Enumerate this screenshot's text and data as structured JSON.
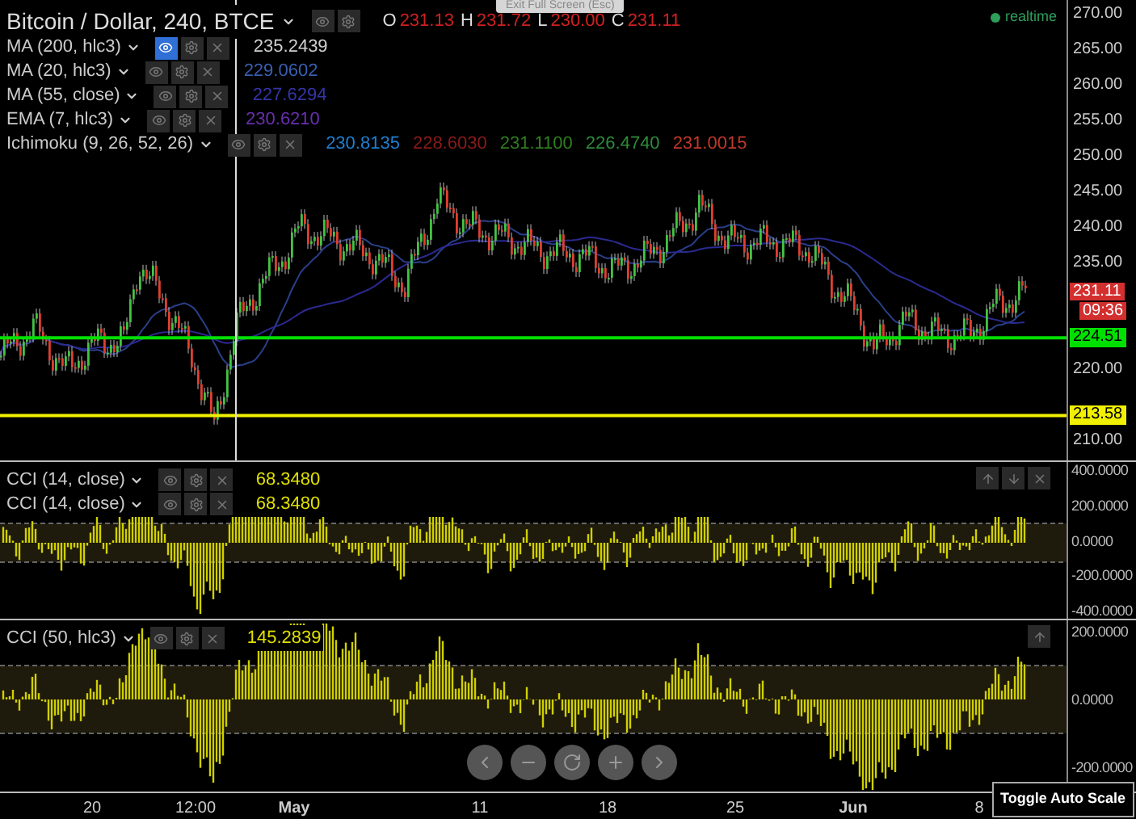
{
  "tooltip": "Exit Full Screen (Esc)",
  "main_pane": {
    "title": "Bitcoin / Dollar, 240, BTCE",
    "ohlc": [
      {
        "label": "O",
        "value": "231.13"
      },
      {
        "label": "H",
        "value": "231.72"
      },
      {
        "label": "L",
        "value": "230.00"
      },
      {
        "label": "C",
        "value": "231.11"
      }
    ],
    "status": {
      "label": "realtime",
      "color": "#2e9e5b"
    },
    "indicators": [
      {
        "name": "MA (200, hlc3)",
        "selected": true,
        "values": [
          {
            "text": "235.2439",
            "color": "#d0d0d0"
          }
        ]
      },
      {
        "name": "MA (20, hlc3)",
        "selected": false,
        "values": [
          {
            "text": "229.0602",
            "color": "#3a5fb0"
          }
        ]
      },
      {
        "name": "MA (55, close)",
        "selected": false,
        "values": [
          {
            "text": "227.6294",
            "color": "#3535a8"
          }
        ]
      },
      {
        "name": "EMA (7, hlc3)",
        "selected": false,
        "values": [
          {
            "text": "230.6210",
            "color": "#6a2fb0"
          }
        ]
      },
      {
        "name": "Ichimoku (9, 26, 52, 26)",
        "selected": false,
        "values": [
          {
            "text": "230.8135",
            "color": "#1e7fd0"
          },
          {
            "text": "228.6030",
            "color": "#8b1a1a"
          },
          {
            "text": "231.1100",
            "color": "#2f7d1f"
          },
          {
            "text": "226.4740",
            "color": "#2e8b3a"
          },
          {
            "text": "231.0015",
            "color": "#c0392b"
          }
        ]
      }
    ],
    "price_axis": [
      "270.00",
      "265.00",
      "260.00",
      "255.00",
      "250.00",
      "245.00",
      "240.00",
      "235.00",
      "220.00",
      "210.00"
    ],
    "price_badges": [
      {
        "text": "231.11",
        "color": "#d32f2f"
      },
      {
        "text": "09:36",
        "color": "#d32f2f"
      }
    ],
    "horizontal_lines": [
      {
        "text": "224.51",
        "color": "#00e000"
      },
      {
        "text": "213.58",
        "color": "#f0f000"
      }
    ]
  },
  "cci_panes": [
    {
      "indicators": [
        {
          "name": "CCI (14, close)",
          "value": "68.3480"
        },
        {
          "name": "CCI (14, close)",
          "value": "68.3480"
        }
      ],
      "axis": [
        "400.0000",
        "200.0000",
        "0.0000",
        "-200.0000",
        "-400.0000"
      ],
      "controls": [
        {
          "kind": "up"
        },
        {
          "kind": "down"
        },
        {
          "kind": "close"
        }
      ]
    },
    {
      "indicators": [
        {
          "name": "CCI (50, hlc3)",
          "value": "145.2839"
        }
      ],
      "axis": [
        "200.0000",
        "0.0000",
        "-200.0000"
      ],
      "controls": [
        {
          "kind": "up"
        }
      ]
    }
  ],
  "time_axis": [
    {
      "text": "20",
      "bold": false
    },
    {
      "text": "12:00",
      "bold": false
    },
    {
      "text": "May",
      "bold": true
    },
    {
      "text": "11",
      "bold": false
    },
    {
      "text": "18",
      "bold": false
    },
    {
      "text": "25",
      "bold": false
    },
    {
      "text": "Jun",
      "bold": true
    },
    {
      "text": "8",
      "bold": false
    }
  ],
  "toggle_button": "Toggle Auto Scale"
}
